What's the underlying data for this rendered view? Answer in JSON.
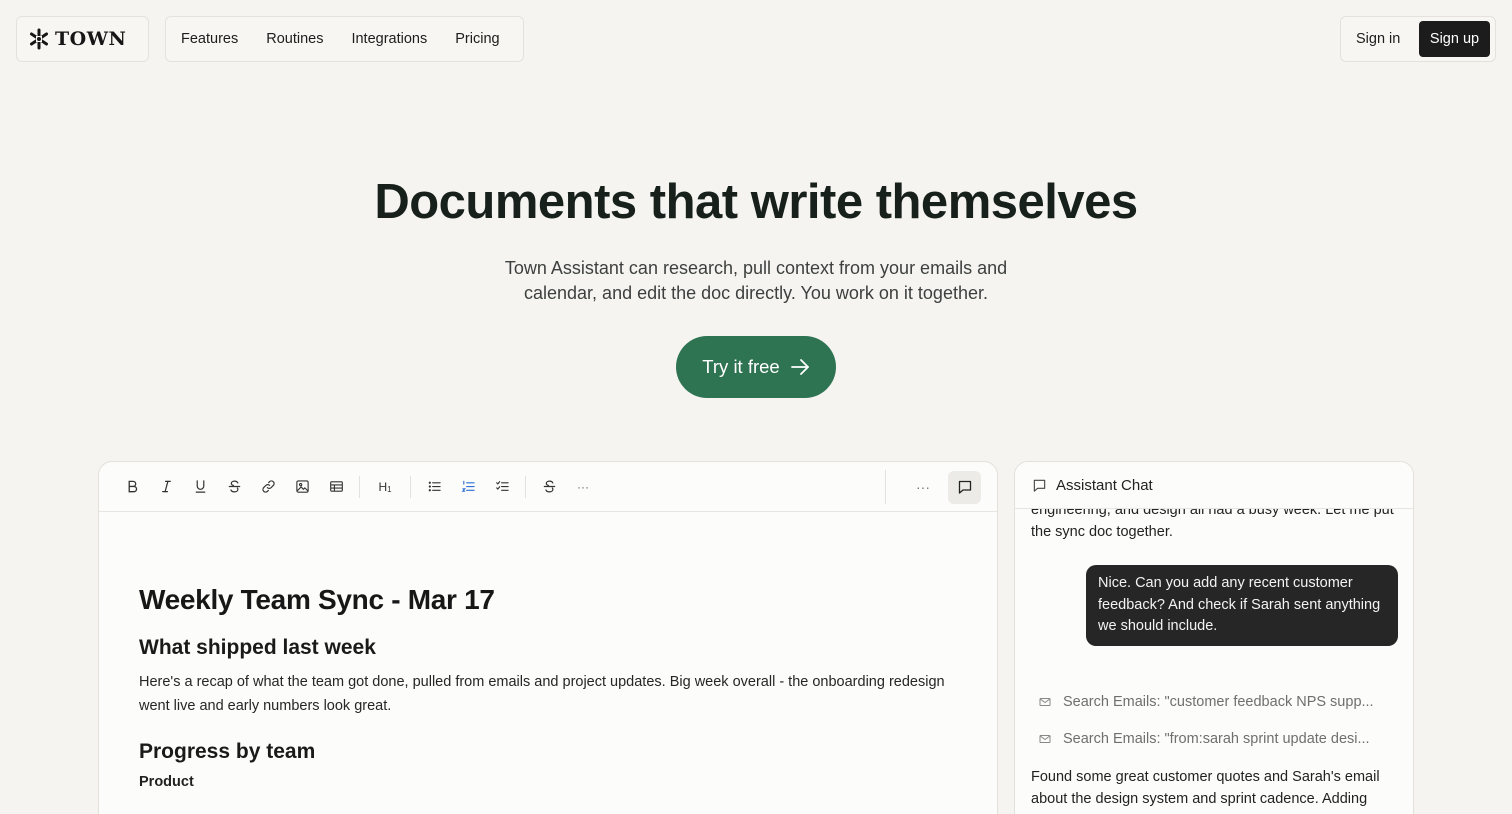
{
  "nav": {
    "logo_text": "TOWN",
    "links": [
      "Features",
      "Routines",
      "Integrations",
      "Pricing"
    ],
    "signin": "Sign in",
    "signup": "Sign up"
  },
  "hero": {
    "title": "Documents that write themselves",
    "subtitle_line1": "Town Assistant can research, pull context from your emails and",
    "subtitle_line2": "calendar, and edit the doc directly. You work on it together.",
    "cta": "Try it free"
  },
  "editor": {
    "toolbar": [
      "bold-icon",
      "italic-icon",
      "underline-icon",
      "strikethrough-icon",
      "link-icon",
      "image-icon",
      "table-icon",
      "heading-icon",
      "bullet-list-icon",
      "numbered-list-icon",
      "checklist-icon",
      "strikethrough-icon",
      "more-icon"
    ],
    "heading_label": "H",
    "heading_sub": "1",
    "more_label": "···",
    "right_more_label": "···",
    "doc_title": "Weekly Team Sync - Mar 17",
    "section1_heading": "What shipped last week",
    "section1_body": "Here's a recap of what the team got done, pulled from emails and project updates. Big week overall - the onboarding redesign went live and early numbers look great.",
    "section2_heading": "Progress by team",
    "section2_sub": "Product"
  },
  "chat": {
    "title": "Assistant Chat",
    "assistant_msg1": "engineering, and design all had a busy week. Let me put the sync doc together.",
    "user_msg": "Nice. Can you add any recent customer feedback? And check if Sarah sent anything we should include.",
    "tool_calls": [
      "Search Emails: \"customer feedback NPS supp...",
      "Search Emails: \"from:sarah sprint update desi..."
    ],
    "assistant_msg2": "Found some great customer quotes and Sarah's email about the design system and sprint cadence. Adding both..."
  },
  "colors": {
    "background": "#f5f4f1",
    "accent_green": "#2f7452",
    "dark_button": "#1c1c1c",
    "user_bubble": "#262626"
  }
}
